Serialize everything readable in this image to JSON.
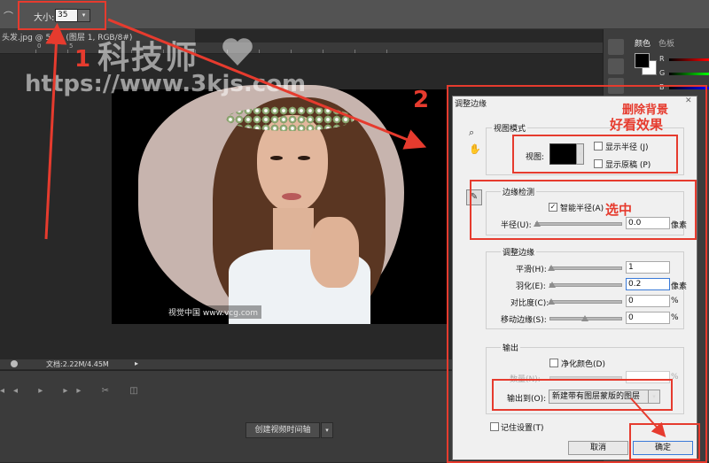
{
  "option_bar": {
    "size_label": "大小:",
    "size_value": "35"
  },
  "document": {
    "tab_label": "头发.jpg @ 50% (图层 1, RGB/8#)"
  },
  "ruler": {
    "ticks": [
      "0",
      "5"
    ]
  },
  "watermark": {
    "title": "科技师",
    "url": "https://www.3kjs.com"
  },
  "photo": {
    "watermark": "视觉中国 www.vcg.com"
  },
  "status": {
    "doc_info": "文档:2.22M/4.45M"
  },
  "timeline": {
    "controls": "◂◂ ▸ ▸▸ ✂ ◫",
    "create_button": "创建视频时间轴"
  },
  "panels": {
    "tab_color": "颜色",
    "tab_swatches": "色板",
    "slider_r": "R",
    "slider_g": "G",
    "slider_b": "B"
  },
  "dialog": {
    "title": "调整边缘",
    "view_mode": {
      "heading": "视图模式",
      "view_label": "视图:",
      "show_radius": "显示半径 (J)",
      "show_original": "显示原稿 (P)"
    },
    "edge_detect": {
      "heading": "边缘检测",
      "smart_radius": "智能半径(A)",
      "radius_label": "半径(U):",
      "radius_value": "0.0",
      "radius_unit": "像素"
    },
    "adjust_edge": {
      "heading": "调整边缘",
      "rows": [
        {
          "label": "平滑(H):",
          "value": "1",
          "unit": ""
        },
        {
          "label": "羽化(E):",
          "value": "0.2",
          "unit": "像素"
        },
        {
          "label": "对比度(C):",
          "value": "0",
          "unit": "%"
        },
        {
          "label": "移动边缘(S):",
          "value": "0",
          "unit": "%"
        }
      ]
    },
    "output": {
      "heading": "输出",
      "decontaminate": "净化颜色(D)",
      "amount_label": "数量(N):",
      "amount_unit": "%",
      "output_to_label": "输出到(O):",
      "output_to_value": "新建带有图层蒙版的图层"
    },
    "remember": "记住设置(T)",
    "cancel": "取消",
    "ok": "确定"
  },
  "annotations": {
    "num1": "1",
    "num2": "2",
    "hint_bg": "删除背景",
    "hint_effect": "好看效果",
    "hint_select": "选中"
  },
  "colors": {
    "annotation_red": "#e63b2e",
    "ps_dark": "#282828",
    "dialog_bg": "#f0f0f0"
  }
}
